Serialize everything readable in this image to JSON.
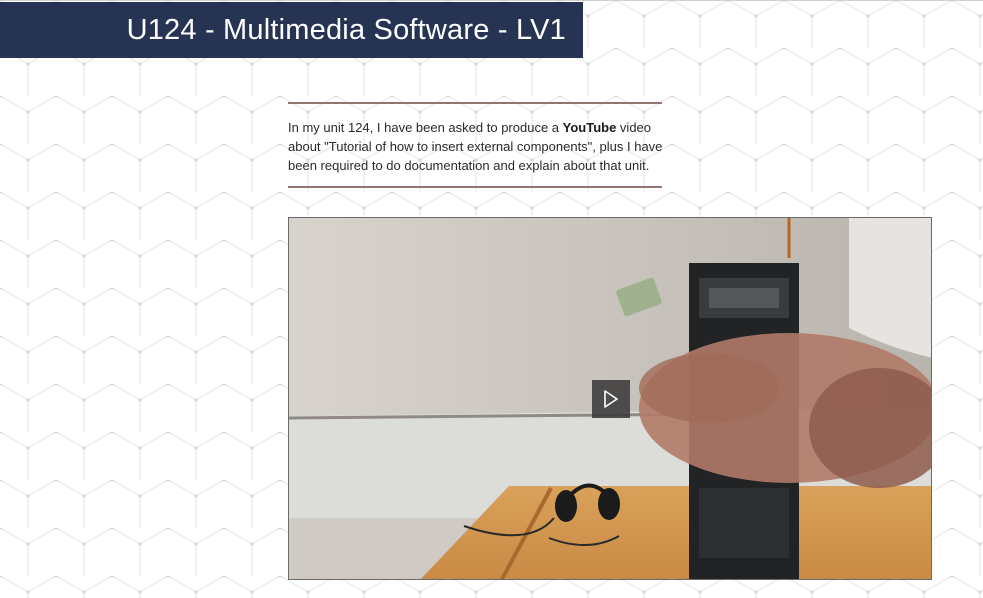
{
  "header": {
    "title": "U124 - Multimedia Software - LV1"
  },
  "intro": {
    "text_before": "In my unit 124, I have been asked to produce a ",
    "text_bold": "YouTube",
    "text_after": " video about \"Tutorial of how to insert external components\", plus I have been required to do documentation and explain about that unit."
  },
  "video": {
    "play_icon": "play-icon"
  },
  "colors": {
    "banner": "#263353",
    "rule": "#8d7770",
    "text": "#2a2a2a"
  }
}
